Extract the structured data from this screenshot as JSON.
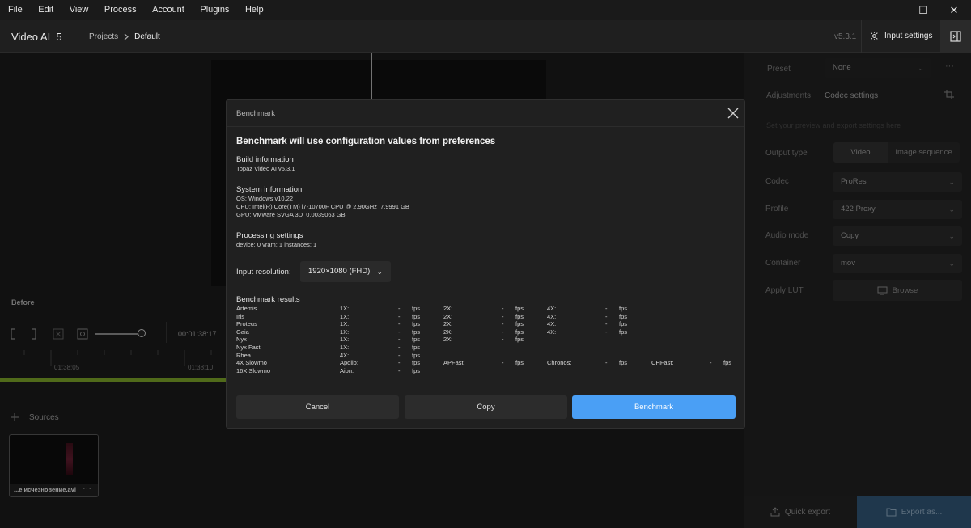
{
  "menubar": {
    "items": [
      "File",
      "Edit",
      "View",
      "Process",
      "Account",
      "Plugins",
      "Help"
    ],
    "minimize": "—",
    "maximize": "☐",
    "close": "✕"
  },
  "header": {
    "app_title": "Video AI  5",
    "breadcrumb_root": "Projects",
    "breadcrumb_current": "Default",
    "version": "v5.3.1",
    "input_settings": "Input settings"
  },
  "viewer": {
    "before_label": "Before",
    "timecode": "00:01:38:17",
    "tick_labels": [
      "01:38:05",
      "01:38:10"
    ],
    "sources_label": "Sources",
    "source_file": "...е исчезновение.avi",
    "more": "···"
  },
  "right_panel": {
    "preset_label": "Preset",
    "preset_value": "None",
    "tab_adjustments": "Adjustments",
    "tab_codec": "Codec settings",
    "hint": "Set your preview and export settings here",
    "output_type_label": "Output type",
    "output_video": "Video",
    "output_image_seq": "Image sequence",
    "codec_label": "Codec",
    "codec_value": "ProRes",
    "profile_label": "Profile",
    "profile_value": "422 Proxy",
    "audio_label": "Audio mode",
    "audio_value": "Copy",
    "container_label": "Container",
    "container_value": "mov",
    "lut_label": "Apply LUT",
    "lut_browse": "Browse",
    "quick_export": "Quick export",
    "export_as": "Export as..."
  },
  "modal": {
    "title": "Benchmark",
    "headline": "Benchmark will use configuration values from preferences",
    "build_title": "Build information",
    "build_lines": [
      "Topaz Video AI v5.3.1"
    ],
    "system_title": "System information",
    "system_lines": [
      "OS: Windows v10.22",
      "CPU: Intel(R) Core(TM) i7-10700F CPU @ 2.90GHz  7.9991 GB",
      "GPU: VMware SVGA 3D  0.0039063 GB"
    ],
    "processing_title": "Processing settings",
    "processing_lines": [
      "device: 0 vram: 1 instances: 1"
    ],
    "resolution_label": "Input resolution:",
    "resolution_value": "1920×1080 (FHD)",
    "results_title": "Benchmark results",
    "results": [
      {
        "model": "Artemis",
        "cells": [
          [
            "1X:",
            "-",
            "fps"
          ],
          [
            "2X:",
            "-",
            "fps"
          ],
          [
            "4X:",
            "-",
            "fps"
          ]
        ]
      },
      {
        "model": "Iris",
        "cells": [
          [
            "1X:",
            "-",
            "fps"
          ],
          [
            "2X:",
            "-",
            "fps"
          ],
          [
            "4X:",
            "-",
            "fps"
          ]
        ]
      },
      {
        "model": "Proteus",
        "cells": [
          [
            "1X:",
            "-",
            "fps"
          ],
          [
            "2X:",
            "-",
            "fps"
          ],
          [
            "4X:",
            "-",
            "fps"
          ]
        ]
      },
      {
        "model": "Gaia",
        "cells": [
          [
            "1X:",
            "-",
            "fps"
          ],
          [
            "2X:",
            "-",
            "fps"
          ],
          [
            "4X:",
            "-",
            "fps"
          ]
        ]
      },
      {
        "model": "Nyx",
        "cells": [
          [
            "1X:",
            "-",
            "fps"
          ],
          [
            "2X:",
            "-",
            "fps"
          ]
        ]
      },
      {
        "model": "Nyx Fast",
        "cells": [
          [
            "1X:",
            "-",
            "fps"
          ]
        ]
      },
      {
        "model": "Rhea",
        "cells": [
          [
            "4X:",
            "-",
            "fps"
          ]
        ]
      },
      {
        "model": "4X Slowmo",
        "cells": [
          [
            "Apollo:",
            "-",
            "fps"
          ],
          [
            "APFast:",
            "-",
            "fps"
          ],
          [
            "Chronos:",
            "-",
            "fps"
          ],
          [
            "CHFast:",
            "-",
            "fps"
          ]
        ]
      },
      {
        "model": "16X Slowmo",
        "cells": [
          [
            "Aion:",
            "-",
            "fps"
          ]
        ]
      }
    ],
    "cancel": "Cancel",
    "copy": "Copy",
    "benchmark": "Benchmark"
  },
  "colors": {
    "accent": "#4a9ff5",
    "timeline_green": "#6b8e23",
    "modal_bg": "#202020"
  }
}
